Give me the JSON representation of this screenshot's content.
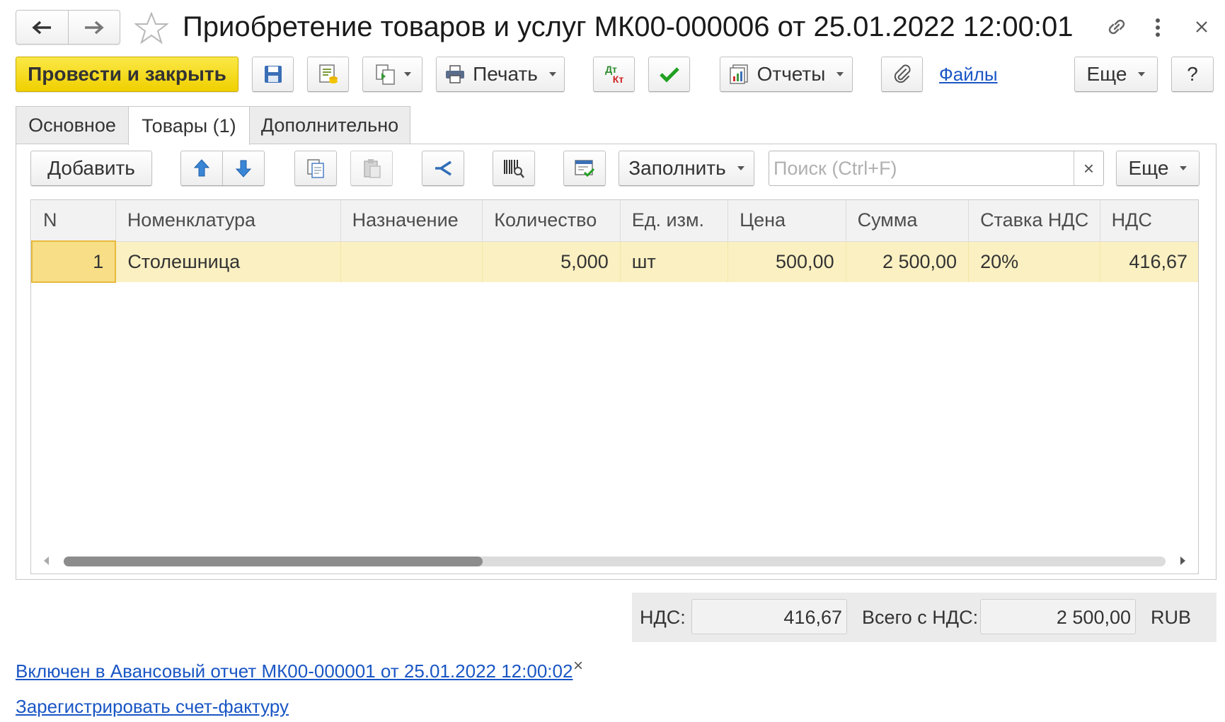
{
  "window": {
    "title": "Приобретение товаров и услуг МК00-000006 от 25.01.2022 12:00:01",
    "icons": [
      "back-arrow-icon",
      "forward-arrow-icon",
      "star-icon",
      "link-icon",
      "more-vertical-icon",
      "close-icon"
    ]
  },
  "toolbar": {
    "post_close_label": "Провести и закрыть",
    "print_label": "Печать",
    "dtkt_top": "Дт",
    "dtkt_bottom": "Кт",
    "reports_label": "Отчеты",
    "files_label": "Файлы",
    "more_label": "Еще",
    "help_label": "?",
    "accent_color": "#f2d600"
  },
  "tabs": [
    {
      "label": "Основное",
      "active": false
    },
    {
      "label": "Товары (1)",
      "active": true
    },
    {
      "label": "Дополнительно",
      "active": false
    }
  ],
  "table_toolbar": {
    "add_label": "Добавить",
    "fill_label": "Заполнить",
    "search_placeholder": "Поиск (Ctrl+F)",
    "clear_label": "×",
    "more_label": "Еще"
  },
  "table": {
    "columns": [
      "N",
      "Номенклатура",
      "Назначение",
      "Количество",
      "Ед. изм.",
      "Цена",
      "Сумма",
      "Ставка НДС",
      "НДС"
    ],
    "rows": [
      {
        "n": "1",
        "item": "Столешница",
        "purpose": "",
        "qty": "5,000",
        "unit": "шт",
        "price": "500,00",
        "sum": "2 500,00",
        "vat_rate": "20%",
        "vat": "416,67"
      }
    ],
    "selected_row_color": "#fbf0c2"
  },
  "totals": {
    "vat_label": "НДС:",
    "vat_value": "416,67",
    "total_label": "Всего с НДС:",
    "total_value": "2 500,00",
    "currency": "RUB"
  },
  "footer": {
    "advance_report_link": "Включен в Авансовый отчет МК00-000001 от 25.01.2022 12:00:02",
    "close_label": "×",
    "register_invoice_link": "Зарегистрировать счет-фактуру"
  }
}
